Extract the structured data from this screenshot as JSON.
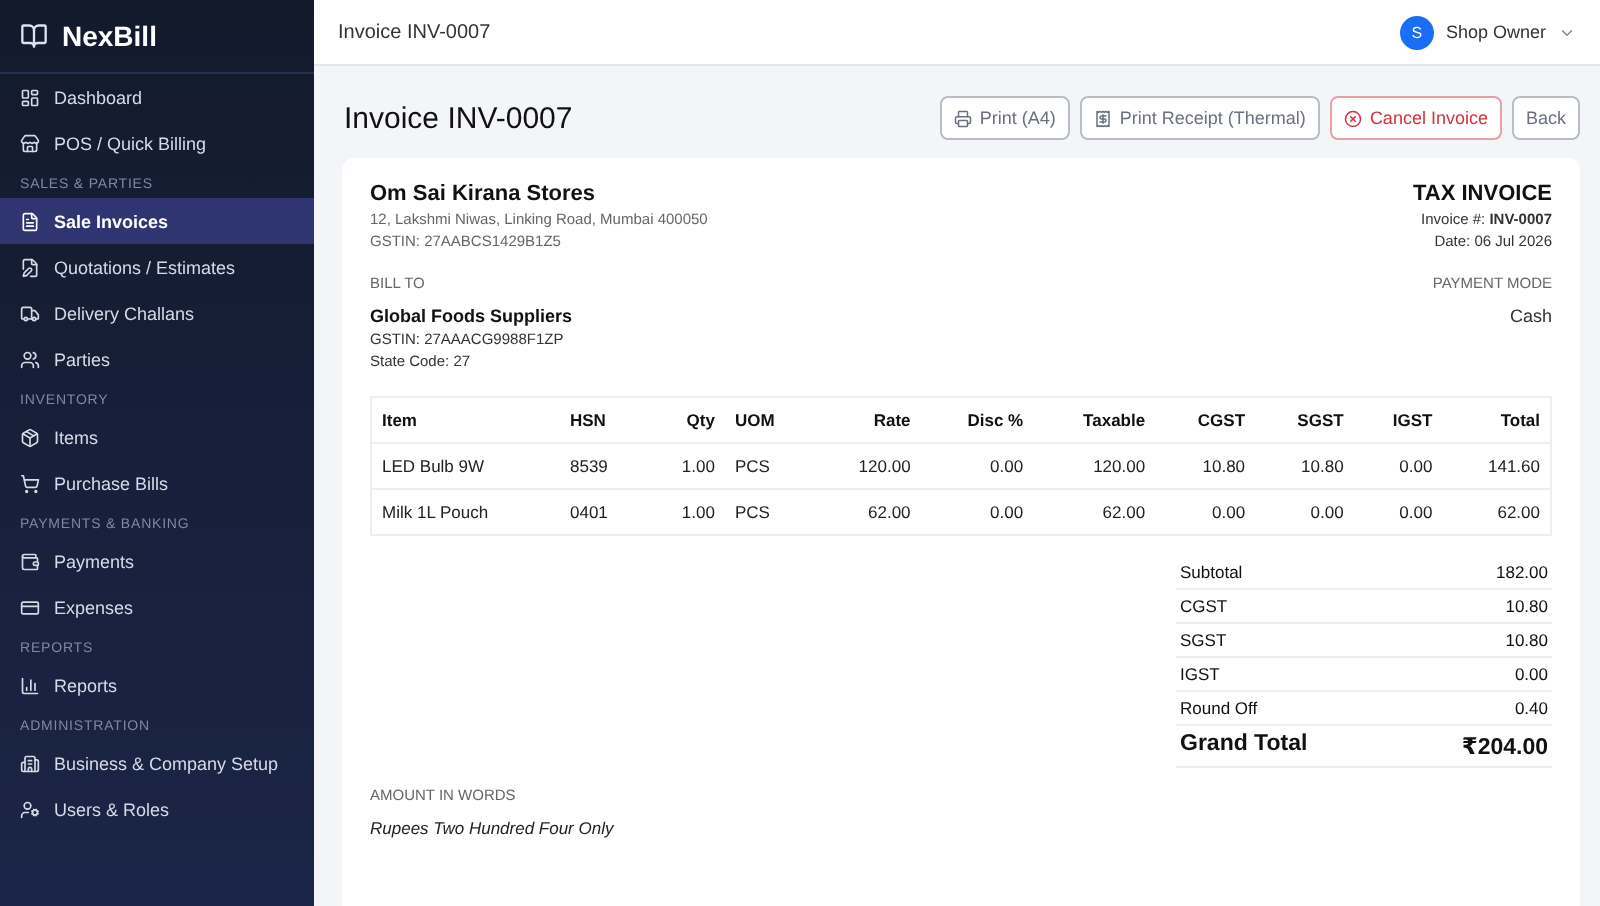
{
  "brand": {
    "name": "NexBill"
  },
  "sidebar": {
    "sections": [
      {
        "items": [
          {
            "label": "Dashboard",
            "selected": false
          },
          {
            "label": "POS / Quick Billing",
            "selected": false
          }
        ]
      },
      {
        "heading": "SALES & PARTIES",
        "items": [
          {
            "label": "Sale Invoices",
            "selected": true
          },
          {
            "label": "Quotations / Estimates",
            "selected": false
          },
          {
            "label": "Delivery Challans",
            "selected": false
          },
          {
            "label": "Parties",
            "selected": false
          }
        ]
      },
      {
        "heading": "INVENTORY",
        "items": [
          {
            "label": "Items",
            "selected": false
          },
          {
            "label": "Purchase Bills",
            "selected": false
          }
        ]
      },
      {
        "heading": "PAYMENTS & BANKING",
        "items": [
          {
            "label": "Payments",
            "selected": false
          },
          {
            "label": "Expenses",
            "selected": false
          }
        ]
      },
      {
        "heading": "REPORTS",
        "items": [
          {
            "label": "Reports",
            "selected": false
          }
        ]
      },
      {
        "heading": "ADMINISTRATION",
        "items": [
          {
            "label": "Business & Company Setup",
            "selected": false
          },
          {
            "label": "Users & Roles",
            "selected": false
          }
        ]
      }
    ]
  },
  "topbar": {
    "breadcrumb": "Invoice INV-0007",
    "user": {
      "initial": "S",
      "name": "Shop Owner"
    }
  },
  "page": {
    "title": "Invoice INV-0007",
    "actions": [
      {
        "label": "Print (A4)",
        "kind": "print"
      },
      {
        "label": "Print Receipt (Thermal)",
        "kind": "receipt"
      },
      {
        "label": "Cancel Invoice",
        "kind": "danger"
      },
      {
        "label": "Back",
        "kind": "plain"
      }
    ]
  },
  "invoice": {
    "seller": {
      "name": "Om Sai Kirana Stores",
      "address": "12, Lakshmi Niwas, Linking Road, Mumbai 400050",
      "gstin": "GSTIN: 27AABCS1429B1Z5"
    },
    "doc_title": "TAX INVOICE",
    "number": "Invoice #: **INV-0007**",
    "date": "Date: 06 Jul 2026",
    "bill_to": {
      "heading": "BILL TO",
      "name": "Global Foods Suppliers",
      "gstin": "GSTIN: 27AAACG9988F1ZP",
      "state": "State Code: 27"
    },
    "payment": {
      "heading": "PAYMENT MODE",
      "value": "Cash"
    },
    "table": {
      "columns": [
        {
          "label": "Item",
          "numeric": false
        },
        {
          "label": "HSN",
          "numeric": false
        },
        {
          "label": "Qty",
          "numeric": true
        },
        {
          "label": "UOM",
          "numeric": false
        },
        {
          "label": "Rate",
          "numeric": true
        },
        {
          "label": "Disc %",
          "numeric": true
        },
        {
          "label": "Taxable",
          "numeric": true
        },
        {
          "label": "CGST",
          "numeric": true
        },
        {
          "label": "SGST",
          "numeric": true
        },
        {
          "label": "IGST",
          "numeric": true
        },
        {
          "label": "Total",
          "numeric": true
        }
      ],
      "rows": [
        [
          "LED Bulb 9W",
          "8539",
          "1.00",
          "PCS",
          "120.00",
          "0.00",
          "120.00",
          "10.80",
          "10.80",
          "0.00",
          "141.60"
        ],
        [
          "Milk 1L Pouch",
          "0401",
          "1.00",
          "PCS",
          "62.00",
          "0.00",
          "62.00",
          "0.00",
          "0.00",
          "0.00",
          "62.00"
        ]
      ]
    },
    "totals": [
      {
        "label": "Subtotal",
        "value": "182.00",
        "kind": "line"
      },
      {
        "label": "CGST",
        "value": "10.80",
        "kind": "line"
      },
      {
        "label": "SGST",
        "value": "10.80",
        "kind": "line"
      },
      {
        "label": "IGST",
        "value": "0.00",
        "kind": "line"
      },
      {
        "label": "Round Off",
        "value": "0.40",
        "kind": "line"
      },
      {
        "label": "Grand Total",
        "value": "₹204.00",
        "kind": "grand"
      }
    ],
    "words": {
      "heading": "AMOUNT IN WORDS",
      "text": "Rupees Two Hundred Four Only"
    }
  }
}
